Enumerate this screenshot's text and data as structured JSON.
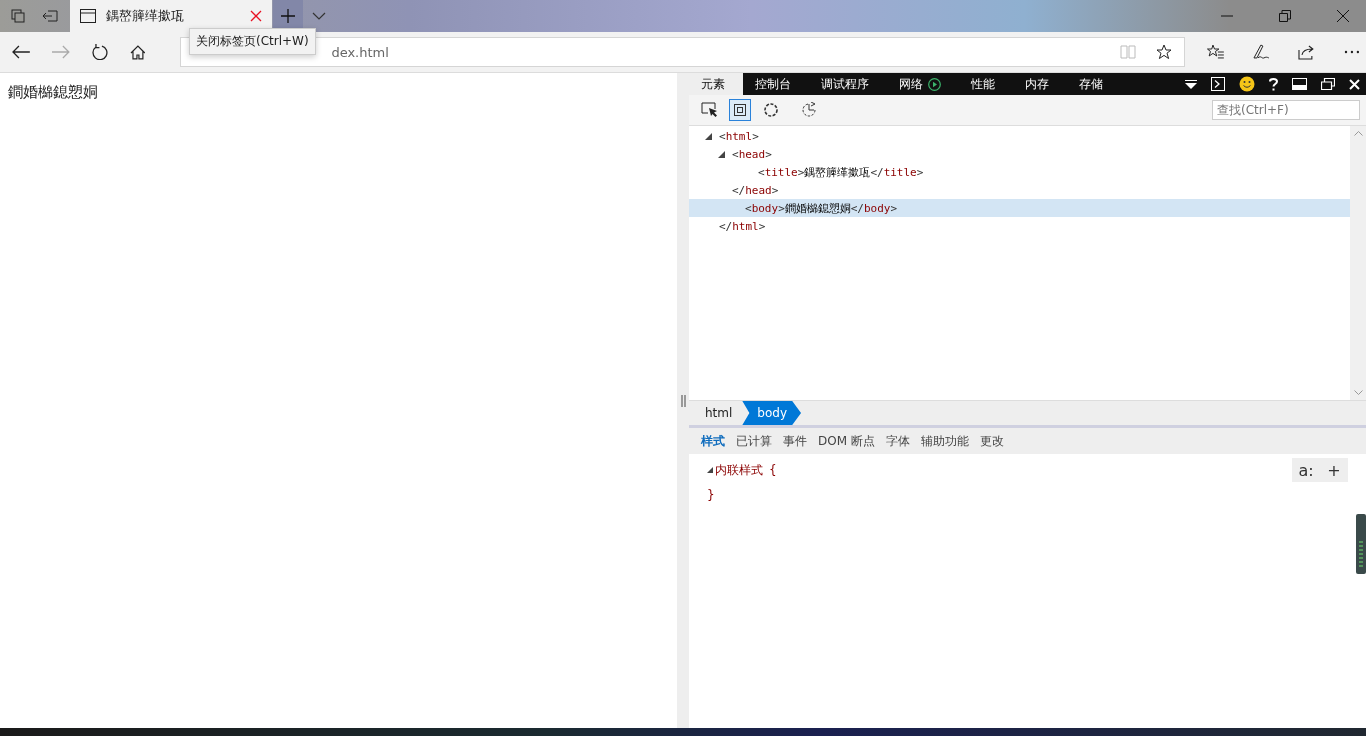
{
  "browser_tab": {
    "title": "鍝嶅簲缂撳瓨",
    "selected": true
  },
  "tooltip": "关闭标签页(Ctrl+W)",
  "address": {
    "value": "dex.html"
  },
  "page": {
    "text": "鐧婚檰鎴愬姛"
  },
  "devtools": {
    "tabs": [
      {
        "label": "元素",
        "selected": true
      },
      {
        "label": "控制台",
        "selected": false
      },
      {
        "label": "调试程序",
        "selected": false
      },
      {
        "label": "网络",
        "selected": false,
        "kind": "record"
      },
      {
        "label": "性能",
        "selected": false
      },
      {
        "label": "内存",
        "selected": false
      },
      {
        "label": "存储",
        "selected": false
      }
    ],
    "search": {
      "placeholder": "查找(Ctrl+F)"
    },
    "tree": [
      {
        "open": "<html>",
        "expanded": true,
        "selected": false,
        "close": "</html>",
        "children": [
          {
            "open": "<head>",
            "expanded": true,
            "selected": false,
            "close": "</head>",
            "children": [
              {
                "open": "<title>鍝嶅簲缂撳瓨</title>",
                "selected": false
              }
            ]
          },
          {
            "open": "<body>鐧婚檰鎴愬姛</body>",
            "selected": true
          }
        ]
      }
    ],
    "breadcrumb": [
      {
        "label": "html",
        "selected": false
      },
      {
        "label": "body",
        "selected": true
      }
    ],
    "subtabs": [
      {
        "label": "样式",
        "selected": true
      },
      {
        "label": "已计算",
        "selected": false
      },
      {
        "label": "事件",
        "selected": false
      },
      {
        "label": "DOM 断点",
        "selected": false
      },
      {
        "label": "字体",
        "selected": false
      },
      {
        "label": "辅助功能",
        "selected": false
      },
      {
        "label": "更改",
        "selected": false
      }
    ],
    "styles": {
      "rule": "内联样式",
      "expanded": true,
      "open_brace": "{",
      "close_brace": "}",
      "buttons": [
        "a:",
        "+"
      ]
    }
  }
}
